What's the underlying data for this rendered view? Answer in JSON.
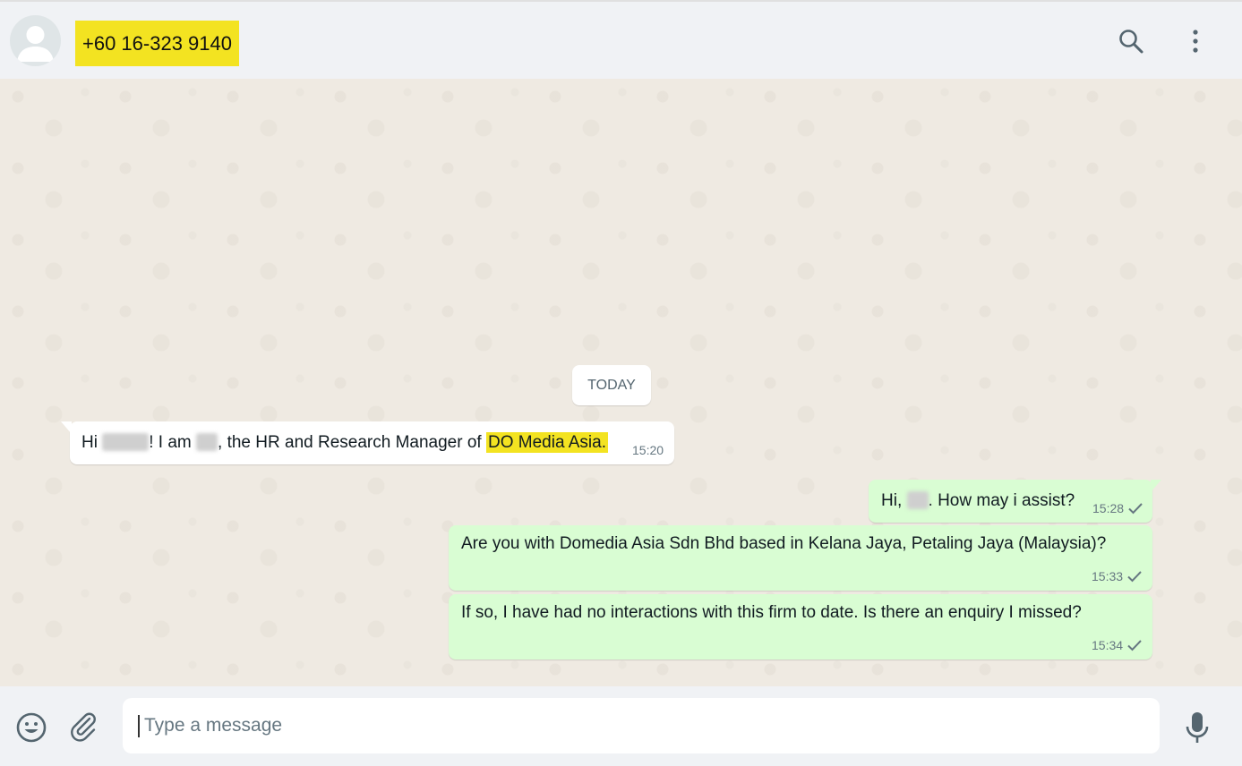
{
  "header": {
    "contact": "+60 16-323 9140",
    "icons": [
      "avatar",
      "search-icon",
      "menu-icon"
    ]
  },
  "chat": {
    "date_label": "TODAY",
    "messages": [
      {
        "direction": "incoming",
        "parts": {
          "greeting": "Hi",
          "i_am": "! I am",
          "role": ", the HR and Research Manager of",
          "company": "DO Media Asia."
        },
        "time": "15:20"
      },
      {
        "direction": "outgoing",
        "parts": {
          "pre": "Hi,",
          "post": ". How may i assist?"
        },
        "time": "15:28",
        "status": "sent"
      },
      {
        "direction": "outgoing",
        "text": "Are you with Domedia Asia Sdn Bhd based in Kelana Jaya, Petaling Jaya (Malaysia)?",
        "time": "15:33",
        "status": "sent"
      },
      {
        "direction": "outgoing",
        "text": "If so, I have had no interactions with this firm to date. Is there an enquiry I missed?",
        "time": "15:34",
        "status": "sent"
      }
    ]
  },
  "composer": {
    "placeholder": "Type a message",
    "icons": [
      "emoji-icon",
      "attach-icon",
      "microphone-icon"
    ]
  },
  "colors": {
    "highlight": "#f3e321",
    "outgoing_bubble": "#d9fdd3",
    "chat_background": "#efeae2",
    "header_background": "#f0f2f5"
  }
}
